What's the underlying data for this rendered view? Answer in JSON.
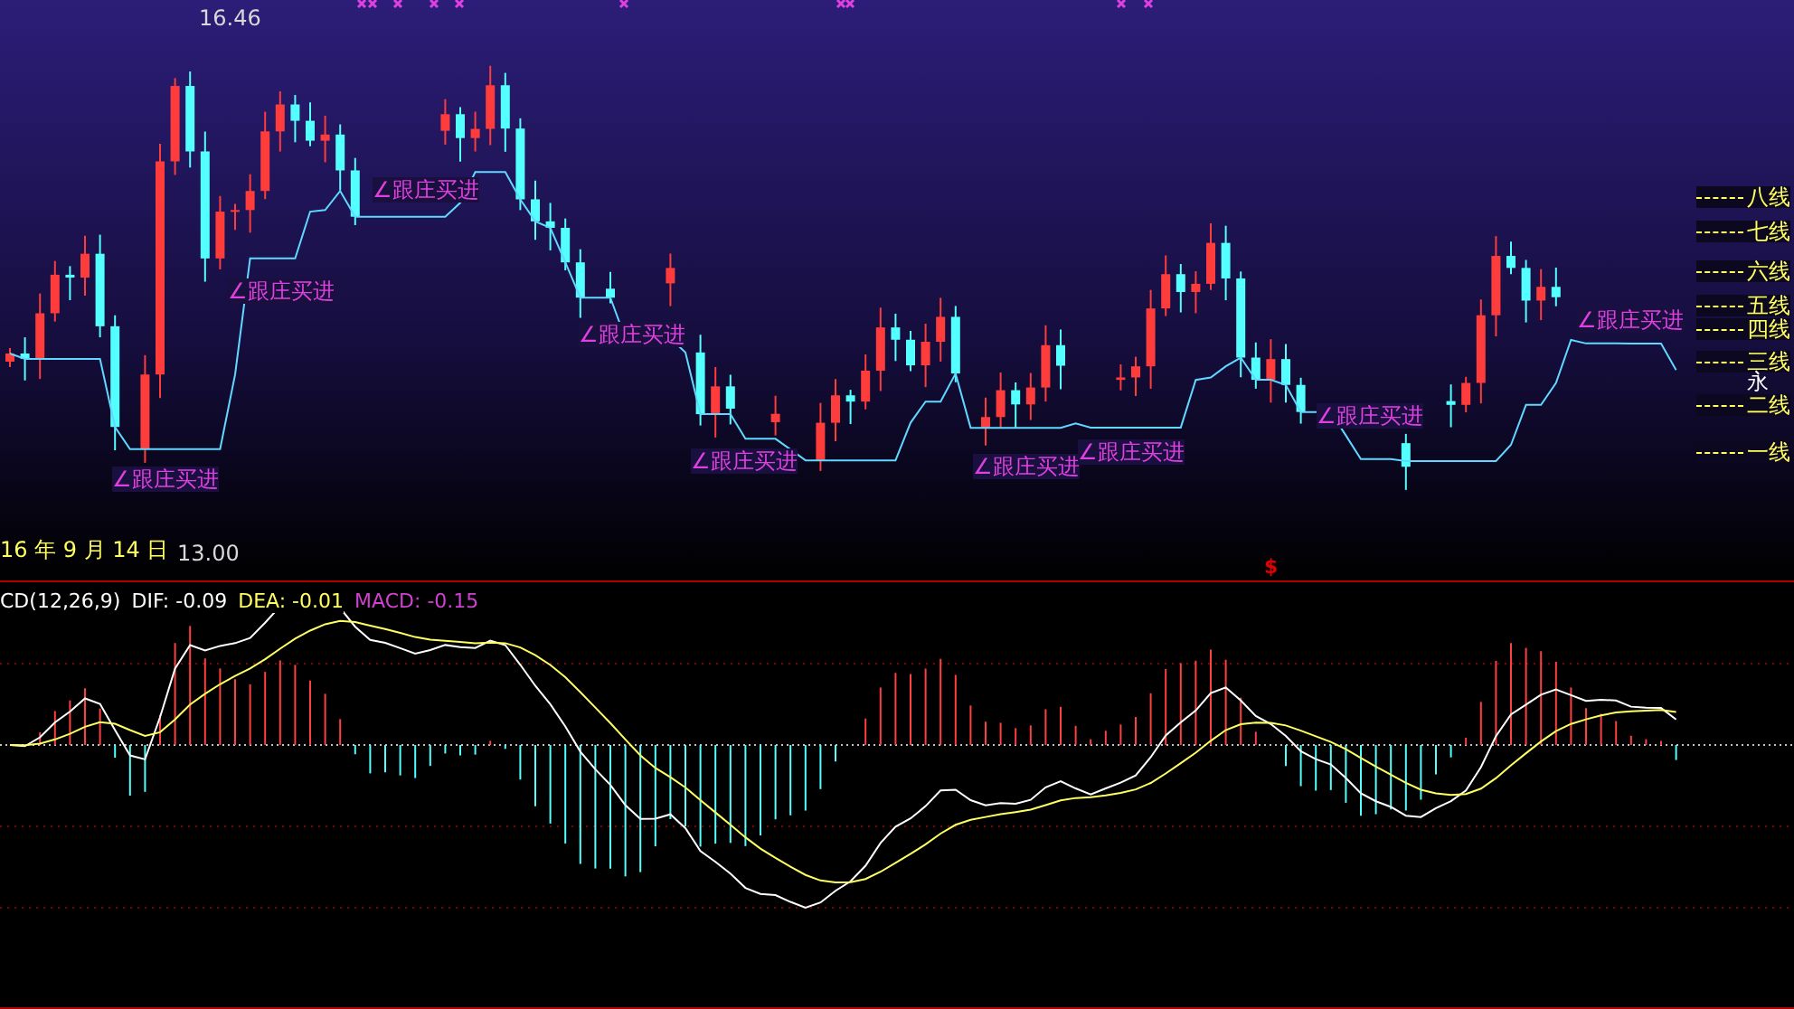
{
  "price_panel": {
    "high_label": "16.46",
    "low_label": "13.00",
    "date_label": "16 年 9 月 14 日",
    "marker": "$",
    "signals": [
      {
        "text": "∠跟庄买进"
      },
      {
        "text": "∠跟庄买进"
      },
      {
        "text": "∠跟庄买进"
      },
      {
        "text": "∠跟庄买进"
      },
      {
        "text": "∠跟庄买进"
      },
      {
        "text": "∠跟庄买进"
      },
      {
        "text": "∠跟庄买进"
      },
      {
        "text": "∠跟庄买进"
      },
      {
        "text": "∠跟庄买进"
      }
    ],
    "level_lines": [
      {
        "label": "八线"
      },
      {
        "label": "七线"
      },
      {
        "label": "六线"
      },
      {
        "label": "五线"
      },
      {
        "label": "四线"
      },
      {
        "label": "三线"
      },
      {
        "label": "二线"
      },
      {
        "label": "一线"
      }
    ],
    "partial_label": "永"
  },
  "macd_panel": {
    "legend": [
      {
        "text": "CD(12,26,9)",
        "kind": "title"
      },
      {
        "text": "DIF: -0.09",
        "kind": "dif"
      },
      {
        "text": "DEA: -0.01",
        "kind": "dea"
      },
      {
        "text": "MACD: -0.15",
        "kind": "macd"
      }
    ]
  }
}
